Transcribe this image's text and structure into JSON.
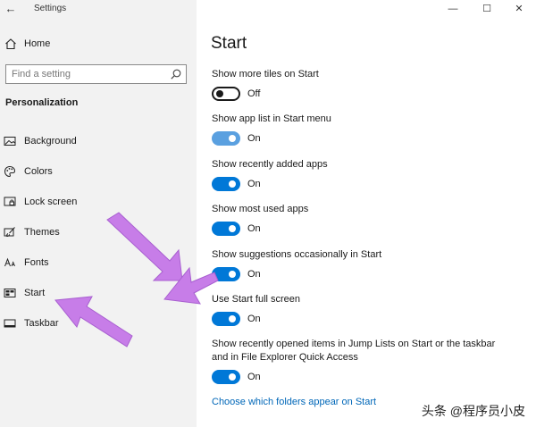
{
  "window": {
    "title": "Settings",
    "back_glyph": "←",
    "minimize_glyph": "—",
    "maximize_glyph": "☐",
    "close_glyph": "✕"
  },
  "sidebar": {
    "home_label": "Home",
    "search_placeholder": "Find a setting",
    "section_title": "Personalization",
    "items": [
      {
        "label": "Background",
        "icon": "image-icon"
      },
      {
        "label": "Colors",
        "icon": "palette-icon"
      },
      {
        "label": "Lock screen",
        "icon": "lock-screen-icon"
      },
      {
        "label": "Themes",
        "icon": "brush-icon"
      },
      {
        "label": "Fonts",
        "icon": "font-icon"
      },
      {
        "label": "Start",
        "icon": "start-icon"
      },
      {
        "label": "Taskbar",
        "icon": "taskbar-icon"
      }
    ]
  },
  "main": {
    "title": "Start",
    "settings": [
      {
        "label": "Show more tiles on Start",
        "state": "Off"
      },
      {
        "label": "Show app list in Start menu",
        "state": "On"
      },
      {
        "label": "Show recently added apps",
        "state": "On"
      },
      {
        "label": "Show most used apps",
        "state": "On"
      },
      {
        "label": "Show suggestions occasionally in Start",
        "state": "On"
      },
      {
        "label": "Use Start full screen",
        "state": "On"
      },
      {
        "label": "Show recently opened items in Jump Lists on Start or the taskbar and in File Explorer Quick Access",
        "state": "On"
      }
    ],
    "link": "Choose which folders appear on Start"
  },
  "watermark": "头条 @程序员小皮",
  "colors": {
    "accent": "#0078d7",
    "link": "#0067b8",
    "annotation_arrow": "#c77de8"
  }
}
